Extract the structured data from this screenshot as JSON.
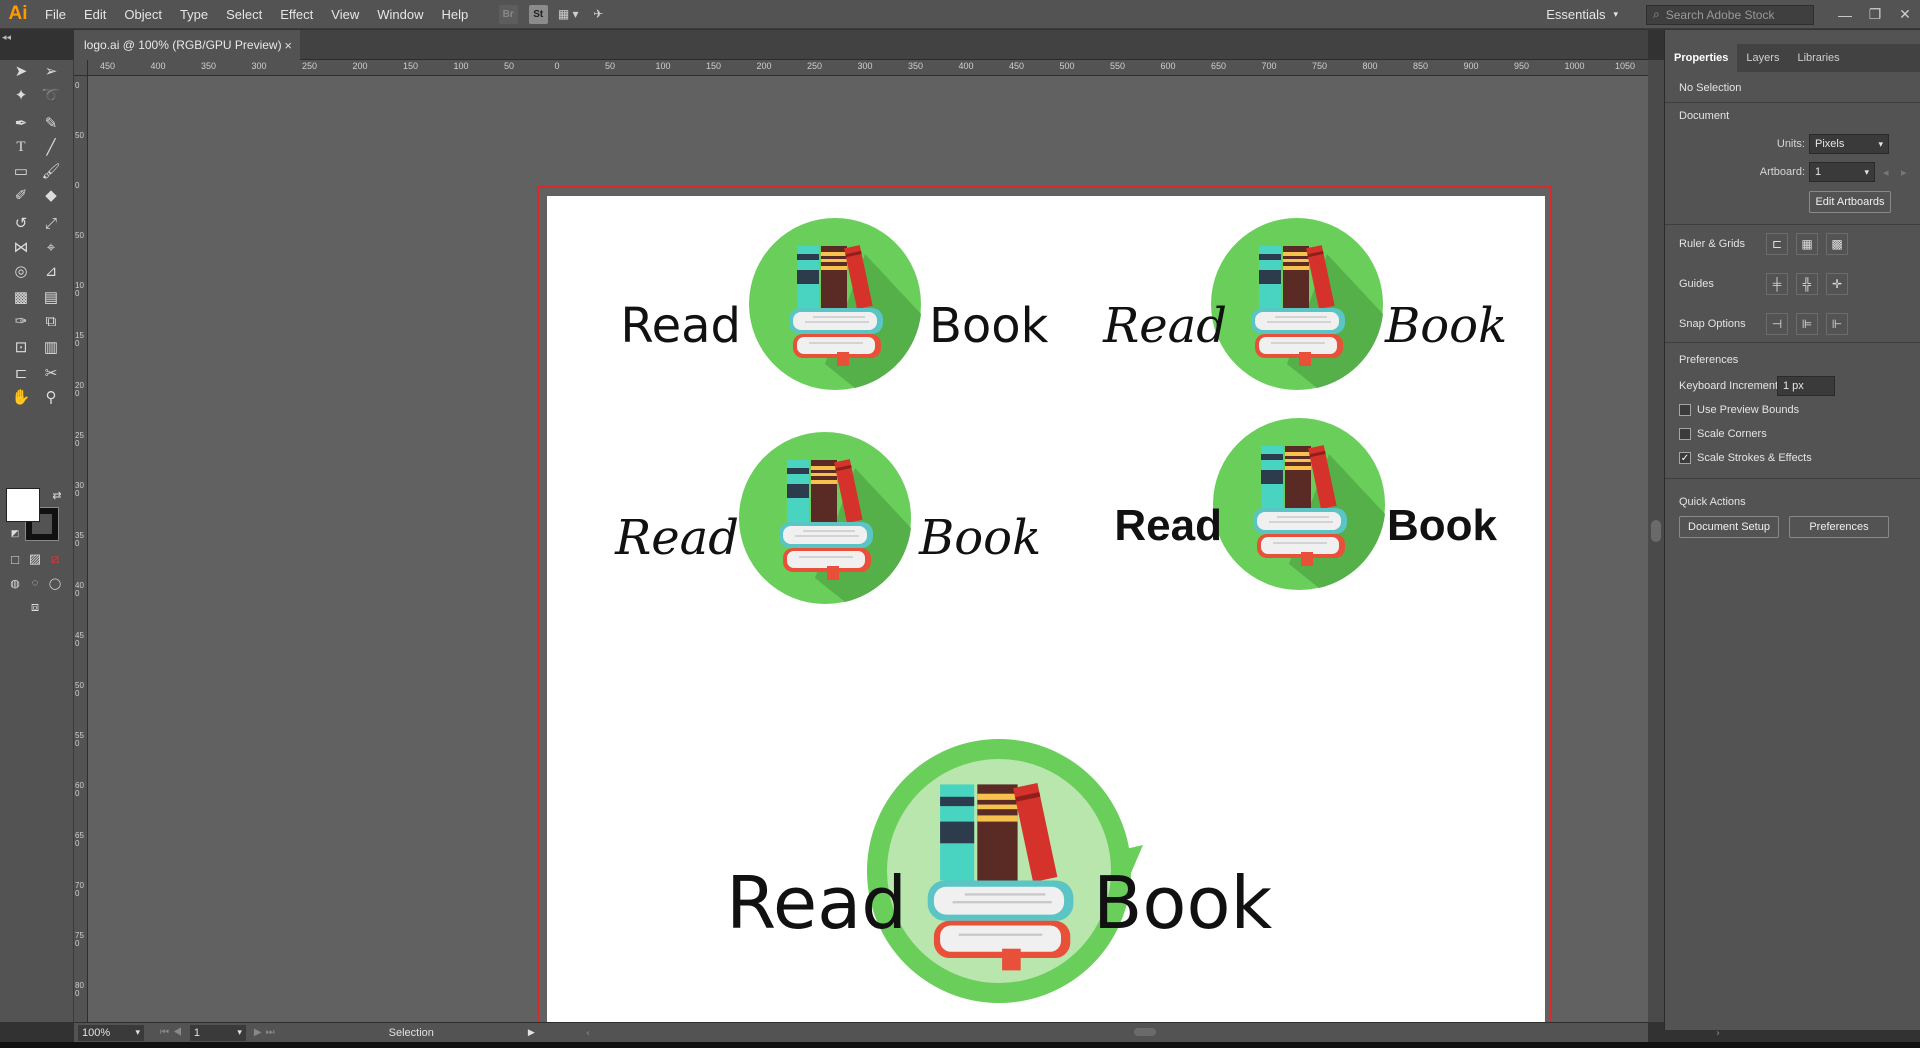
{
  "app": {
    "logo": "Ai",
    "menu": [
      "File",
      "Edit",
      "Object",
      "Type",
      "Select",
      "Effect",
      "View",
      "Window",
      "Help"
    ],
    "workspace": "Essentials",
    "stock_placeholder": "Search Adobe Stock"
  },
  "document": {
    "tab_title": "logo.ai @ 100% (RGB/GPU Preview)",
    "close": "×"
  },
  "ruler": {
    "h_labels": [
      "450",
      "400",
      "350",
      "300",
      "250",
      "200",
      "150",
      "100",
      "50",
      "0",
      "50",
      "100",
      "150",
      "200",
      "250",
      "300",
      "350",
      "400",
      "450",
      "500",
      "550",
      "600",
      "650",
      "700",
      "750",
      "800",
      "850",
      "900",
      "950",
      "1000",
      "1050"
    ],
    "v_labels": [
      "0",
      "50",
      "0",
      "50",
      "100",
      "150",
      "200",
      "250",
      "300",
      "350",
      "400",
      "450",
      "500",
      "550",
      "600",
      "650",
      "700",
      "750",
      "800"
    ]
  },
  "logos": [
    {
      "left": "Read",
      "right": "Book",
      "style": "light-sans"
    },
    {
      "left": "Read",
      "right": "Book",
      "style": "italic-script"
    },
    {
      "left": "Read",
      "right": "Book",
      "style": "italic-script"
    },
    {
      "left": "Read",
      "right": "Book",
      "style": "heavy-bold"
    },
    {
      "left": "Read",
      "right": "Book",
      "style": "light-sans-large"
    }
  ],
  "colors": {
    "circle_green": "#6ace5b",
    "circle_shadow": "#56b04a",
    "book_teal": "#48d4c1",
    "book_dark": "#2c3c4c",
    "book_brown": "#5a2a24",
    "book_yellow": "#f6c14c",
    "book_red": "#d6322c",
    "cover_teal": "#5bc4c4",
    "cover_red": "#e8503a",
    "pages": "#f0f0f0"
  },
  "panel": {
    "tabs": [
      "Properties",
      "Layers",
      "Libraries"
    ],
    "no_selection": "No Selection",
    "document_heading": "Document",
    "units_label": "Units:",
    "units_value": "Pixels",
    "artboard_label": "Artboard:",
    "artboard_value": "1",
    "edit_artboards": "Edit Artboards",
    "ruler_grids": "Ruler & Grids",
    "guides": "Guides",
    "snap_options": "Snap Options",
    "preferences_heading": "Preferences",
    "keyboard_increment_label": "Keyboard Increment:",
    "keyboard_increment_value": "1 px",
    "use_preview_bounds": "Use Preview Bounds",
    "scale_corners": "Scale Corners",
    "scale_strokes": "Scale Strokes & Effects",
    "quick_actions": "Quick Actions",
    "document_setup": "Document Setup",
    "preferences_button": "Preferences"
  },
  "status": {
    "zoom": "100%",
    "artboard": "1",
    "mode": "Selection"
  }
}
